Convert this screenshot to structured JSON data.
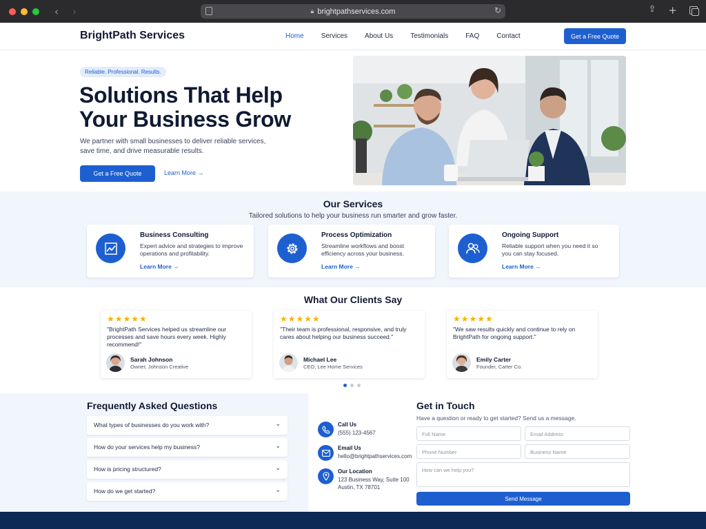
{
  "browser": {
    "url": "brightpathservices.com"
  },
  "nav": {
    "brand": "BrightPath Services",
    "links": [
      "Home",
      "Services",
      "About Us",
      "Testimonials",
      "FAQ",
      "Contact"
    ],
    "active": "Home",
    "cta": "Get a Free Quote"
  },
  "hero": {
    "tag": "Reliable. Professional. Results.",
    "title": "Solutions That Help Your Business Grow",
    "subtitle": "We partner with small businesses to deliver reliable services, save time, and drive measurable results.",
    "cta_primary": "Get a Free Quote",
    "cta_secondary": "Learn More →"
  },
  "services": {
    "title": "Our Services",
    "subtitle": "Tailored solutions to help your business run smarter and grow faster.",
    "items": [
      {
        "icon": "chart-line-icon",
        "name": "Business Consulting",
        "desc": "Expert advice and strategies to improve operations and profitability.",
        "link": "Learn More →"
      },
      {
        "icon": "gear-icon",
        "name": "Process Optimization",
        "desc": "Streamline workflows and boost efficiency across your business.",
        "link": "Learn More →"
      },
      {
        "icon": "users-icon",
        "name": "Ongoing Support",
        "desc": "Reliable support when you need it so you can stay focused.",
        "link": "Learn More →"
      }
    ]
  },
  "testimonials": {
    "title": "What Our Clients Say",
    "items": [
      {
        "stars": "★★★★★",
        "quote": "\"BrightPath Services helped us streamline our processes and save hours every week. Highly recommend!\"",
        "name": "Sarah Johnson",
        "role": "Owner, Johnson Creative"
      },
      {
        "stars": "★★★★★",
        "quote": "\"Their team is professional, responsive, and truly cares about helping our business succeed.\"",
        "name": "Michael Lee",
        "role": "CEO, Lee Home Services"
      },
      {
        "stars": "★★★★★",
        "quote": "\"We saw results quickly and continue to rely on BrightPath for ongoing support.\"",
        "name": "Emily Carter",
        "role": "Founder, Carter Co."
      }
    ],
    "pager_count": 3,
    "pager_active": 1
  },
  "faq": {
    "title": "Frequently Asked Questions",
    "items": [
      "What types of businesses do you work with?",
      "How do your services help my business?",
      "How is pricing structured?",
      "How do we get started?"
    ]
  },
  "contact": {
    "methods": [
      {
        "icon": "phone-icon",
        "label": "Call Us",
        "value": "(555) 123-4567"
      },
      {
        "icon": "mail-icon",
        "label": "Email Us",
        "value": "hello@brightpathservices.com"
      },
      {
        "icon": "map-pin-icon",
        "label": "Our Location",
        "value_line1": "123 Business Way, Suite 100",
        "value_line2": "Austin, TX 78701"
      }
    ],
    "title": "Get in Touch",
    "subtitle": "Have a question or ready to get started? Send us a message.",
    "fields": {
      "full_name": "Full Name",
      "email": "Email Address",
      "phone": "Phone Number",
      "business": "Business Name",
      "message": "How can we help you?"
    },
    "submit": "Send Message"
  },
  "colors": {
    "accent": "#1e5fd0",
    "section_bg": "#f1f5fc",
    "footer": "#0d2a56",
    "star": "#f5b301"
  }
}
